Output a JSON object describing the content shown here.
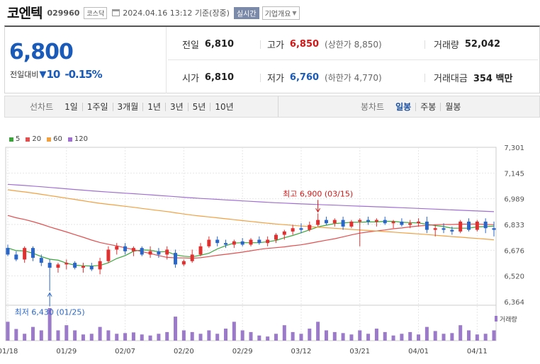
{
  "header": {
    "name": "코엔텍",
    "code": "029960",
    "market": "코스닥",
    "datetime": "2024.04.16 13:12  기준(장중)",
    "realtime": "실시간",
    "company_info": "기업개요"
  },
  "quote": {
    "price": "6,800",
    "change_label": "전일대비",
    "change": "10",
    "change_pct": "-0.15%",
    "prev_label": "전일",
    "prev": "6,810",
    "open_label": "시가",
    "open": "6,810",
    "high_label": "고가",
    "high": "6,850",
    "upper_limit": "(상한가 8,850)",
    "low_label": "저가",
    "low": "6,760",
    "lower_limit": "(하한가 4,770)",
    "volume_label": "거래량",
    "volume": "52,042",
    "amount_label": "거래대금",
    "amount": "354 백만"
  },
  "periods": {
    "line_label": "선차트",
    "line_items": [
      "1일",
      "1주일",
      "3개월",
      "1년",
      "3년",
      "5년",
      "10년"
    ],
    "candle_label": "봉차트",
    "candle_items": [
      "일봉",
      "주봉",
      "월봉"
    ],
    "candle_active": "일봉"
  },
  "legend": [
    {
      "label": "5",
      "color": "#3aa63a"
    },
    {
      "label": "20",
      "color": "#e05050"
    },
    {
      "label": "60",
      "color": "#f0a040"
    },
    {
      "label": "120",
      "color": "#a070d0"
    }
  ],
  "colors": {
    "up": "#e03030",
    "down": "#2a66c8",
    "volume": "#9a7ac9"
  },
  "chart_data": {
    "type": "candlestick",
    "ylim": [
      6364,
      7301
    ],
    "y_ticks": [
      "7,301",
      "7,145",
      "6,989",
      "6,833",
      "6,676",
      "6,520",
      "6,364"
    ],
    "x_ticks": [
      {
        "label": "01/18",
        "i": 0
      },
      {
        "label": "01/29",
        "i": 7
      },
      {
        "label": "02/07",
        "i": 14
      },
      {
        "label": "02/20",
        "i": 21
      },
      {
        "label": "02/29",
        "i": 28
      },
      {
        "label": "03/12",
        "i": 35
      },
      {
        "label": "03/21",
        "i": 42
      },
      {
        "label": "04/01",
        "i": 49
      },
      {
        "label": "04/11",
        "i": 56
      }
    ],
    "high_annotation": "최고 6,900 (03/15)",
    "low_annotation": "최저 6,430 (01/25)",
    "high_index": 37,
    "low_index": 5,
    "volume_label": "거래량",
    "candles": [
      [
        6690,
        6710,
        6640,
        6650
      ],
      [
        6650,
        6670,
        6610,
        6620
      ],
      [
        6620,
        6700,
        6600,
        6690
      ],
      [
        6690,
        6700,
        6610,
        6630
      ],
      [
        6630,
        6650,
        6580,
        6600
      ],
      [
        6600,
        6620,
        6430,
        6570
      ],
      [
        6570,
        6600,
        6540,
        6590
      ],
      [
        6590,
        6620,
        6560,
        6600
      ],
      [
        6600,
        6610,
        6560,
        6570
      ],
      [
        6570,
        6600,
        6540,
        6580
      ],
      [
        6580,
        6600,
        6550,
        6560
      ],
      [
        6560,
        6630,
        6530,
        6610
      ],
      [
        6610,
        6700,
        6600,
        6680
      ],
      [
        6680,
        6720,
        6650,
        6700
      ],
      [
        6700,
        6720,
        6650,
        6670
      ],
      [
        6670,
        6700,
        6640,
        6690
      ],
      [
        6690,
        6700,
        6640,
        6650
      ],
      [
        6650,
        6700,
        6630,
        6670
      ],
      [
        6670,
        6690,
        6630,
        6650
      ],
      [
        6650,
        6700,
        6620,
        6680
      ],
      [
        6660,
        6680,
        6570,
        6590
      ],
      [
        6590,
        6620,
        6580,
        6610
      ],
      [
        6610,
        6680,
        6600,
        6650
      ],
      [
        6650,
        6720,
        6640,
        6700
      ],
      [
        6700,
        6760,
        6690,
        6740
      ],
      [
        6740,
        6760,
        6700,
        6720
      ],
      [
        6720,
        6740,
        6690,
        6710
      ],
      [
        6710,
        6740,
        6690,
        6730
      ],
      [
        6730,
        6750,
        6700,
        6710
      ],
      [
        6710,
        6750,
        6700,
        6740
      ],
      [
        6740,
        6760,
        6710,
        6720
      ],
      [
        6720,
        6760,
        6700,
        6740
      ],
      [
        6740,
        6780,
        6720,
        6770
      ],
      [
        6770,
        6800,
        6740,
        6790
      ],
      [
        6790,
        6830,
        6770,
        6810
      ],
      [
        6810,
        6840,
        6780,
        6800
      ],
      [
        6800,
        6850,
        6790,
        6830
      ],
      [
        6830,
        6900,
        6820,
        6860
      ],
      [
        6860,
        6880,
        6830,
        6840
      ],
      [
        6840,
        6870,
        6820,
        6860
      ],
      [
        6860,
        6880,
        6800,
        6820
      ],
      [
        6820,
        6860,
        6810,
        6850
      ],
      [
        6850,
        6870,
        6700,
        6860
      ],
      [
        6860,
        6880,
        6830,
        6850
      ],
      [
        6850,
        6870,
        6820,
        6860
      ],
      [
        6860,
        6880,
        6830,
        6840
      ],
      [
        6840,
        6860,
        6810,
        6850
      ],
      [
        6850,
        6870,
        6820,
        6830
      ],
      [
        6830,
        6860,
        6810,
        6840
      ],
      [
        6840,
        6870,
        6820,
        6850
      ],
      [
        6850,
        6880,
        6780,
        6800
      ],
      [
        6800,
        6830,
        6760,
        6810
      ],
      [
        6810,
        6840,
        6780,
        6800
      ],
      [
        6800,
        6820,
        6770,
        6790
      ],
      [
        6790,
        6860,
        6780,
        6850
      ],
      [
        6850,
        6870,
        6790,
        6800
      ],
      [
        6800,
        6860,
        6790,
        6850
      ],
      [
        6850,
        6870,
        6780,
        6810
      ],
      [
        6810,
        6850,
        6760,
        6800
      ]
    ],
    "volume": [
      55,
      34,
      20,
      40,
      30,
      95,
      30,
      45,
      30,
      18,
      20,
      40,
      30,
      20,
      22,
      24,
      18,
      15,
      20,
      25,
      70,
      30,
      25,
      20,
      30,
      20,
      35,
      55,
      30,
      25,
      15,
      12,
      20,
      45,
      25,
      20,
      35,
      55,
      30,
      25,
      22,
      18,
      30,
      20,
      35,
      25,
      15,
      20,
      25,
      18,
      40,
      28,
      20,
      22,
      45,
      30,
      18,
      20,
      30
    ]
  }
}
